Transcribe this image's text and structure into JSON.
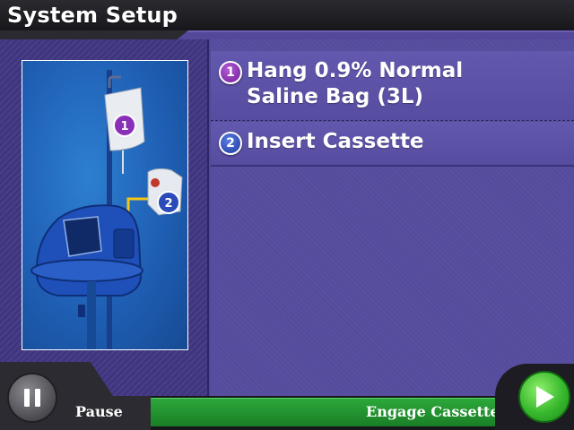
{
  "header": {
    "title": "System Setup"
  },
  "steps": [
    {
      "number": "1",
      "line1": "Hang 0.9% Normal",
      "line2": "Saline Bag (3L)",
      "color": "#8a2fb8"
    },
    {
      "number": "2",
      "line1": "Insert Cassette",
      "color": "#2a4bb8"
    }
  ],
  "illustration": {
    "callout_1": "1",
    "callout_2": "2",
    "arrow_color": "#f5c518"
  },
  "footer": {
    "pause_label": "Pause",
    "engage_label": "Engage Cassette",
    "engage_color": "#2a9c35"
  },
  "icons": {
    "pause": "pause-icon",
    "play": "play-icon"
  }
}
